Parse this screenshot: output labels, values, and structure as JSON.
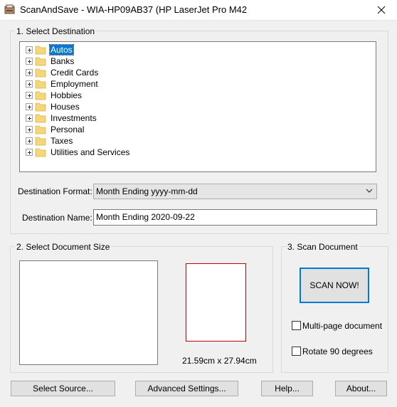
{
  "window": {
    "title": "ScanAndSave - WIA-HP09AB37 (HP LaserJet Pro M42",
    "close_glyph": "✕"
  },
  "destination": {
    "group_label": "1. Select Destination",
    "folders": [
      {
        "label": "Autos",
        "selected": true
      },
      {
        "label": "Banks"
      },
      {
        "label": "Credit Cards"
      },
      {
        "label": "Employment"
      },
      {
        "label": "Hobbies"
      },
      {
        "label": "Houses"
      },
      {
        "label": "Investments"
      },
      {
        "label": "Personal"
      },
      {
        "label": "Taxes"
      },
      {
        "label": "Utilities and Services"
      }
    ],
    "format_label": "Destination Format:",
    "format_value": "Month Ending yyyy-mm-dd",
    "name_label": "Destination Name:",
    "name_value": "Month Ending 2020-09-22"
  },
  "doc_size": {
    "group_label": "2. Select Document Size",
    "size_text": "21.59cm x 27.94cm"
  },
  "scan": {
    "group_label": "3. Scan Document",
    "scan_button": "SCAN NOW!",
    "multi_page_label": "Multi-page document",
    "multi_page_checked": false,
    "rotate_label": "Rotate 90 degrees",
    "rotate_checked": false
  },
  "buttons": {
    "select_source": "Select Source...",
    "advanced_settings": "Advanced Settings...",
    "help": "Help...",
    "about": "About..."
  },
  "colors": {
    "selection": "#0078d7",
    "folder": "#f5d67a",
    "paper_outline": "#c00000"
  }
}
